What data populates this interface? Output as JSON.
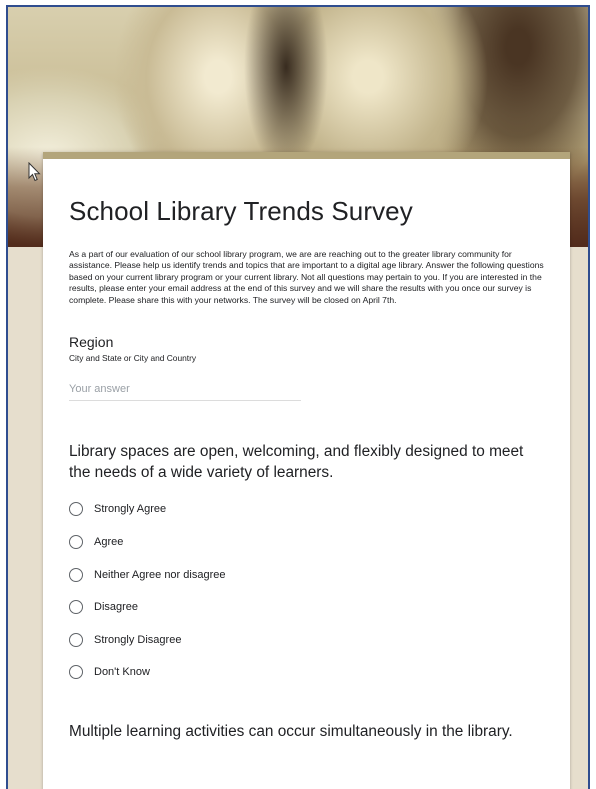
{
  "form": {
    "title": "School Library Trends Survey",
    "description": "As a part of our evaluation of our school library program, we are are reaching out to the greater library community for assistance. Please help us identify trends and topics that are important to a digital age library. Answer the following questions based on your current library program or your current library. Not all questions may pertain to you. If you are interested in the results, please enter your email address at the end of this survey and we will share the results with you once our survey is complete. Please share this with your networks. The survey will be closed on April 7th."
  },
  "questions": [
    {
      "title": "Region",
      "help": "City and State or City and Country",
      "placeholder": "Your answer"
    },
    {
      "title": "Library spaces are open, welcoming, and flexibly designed to meet the needs of a wide variety of learners.",
      "options": [
        "Strongly Agree",
        "Agree",
        "Neither Agree nor disagree",
        "Disagree",
        "Strongly Disagree",
        "Don't Know"
      ]
    },
    {
      "title": "Multiple learning activities can occur simultaneously in the library."
    }
  ],
  "colors": {
    "frame_border": "#2f4d8f",
    "card_accent": "#b3a57b",
    "page_background": "#e6decd"
  },
  "icons": {
    "cursor": "mouse-pointer-icon",
    "radio": "radio-unchecked-icon"
  }
}
